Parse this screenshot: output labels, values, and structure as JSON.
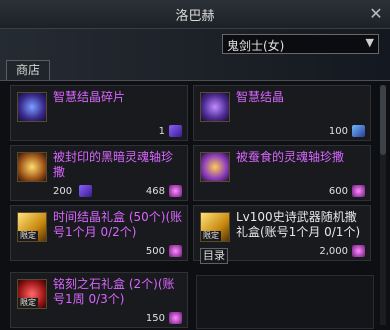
{
  "window": {
    "title": "洛巴赫"
  },
  "class_select": {
    "value": "鬼剑士(女)"
  },
  "tab": {
    "shop": "商店"
  },
  "catalog_button": "目录",
  "items": [
    {
      "name": "智慧结晶碎片",
      "price": "1",
      "icon": "wisdom-crystal-shard-icon"
    },
    {
      "name": "智慧结晶",
      "price": "100",
      "icon": "wisdom-crystal-icon"
    },
    {
      "name": "被封印的黑暗灵魂轴珍撒",
      "price_a": "200",
      "price_b": "468",
      "icon": "sealed-dark-soul-icon"
    },
    {
      "name": "被蚕食的灵魂轴珍撒",
      "price": "600",
      "icon": "eroded-soul-icon"
    },
    {
      "name": "时间结晶礼盒 (50个)(账号1个月 0/2个)",
      "price": "500",
      "tag": "限定",
      "icon": "time-crystal-box-icon"
    },
    {
      "name": "Lv100史诗武器随机撒礼盒(账号1个月 0/1个)",
      "price": "2,000",
      "tag": "限定",
      "icon": "epic-weapon-box-icon"
    },
    {
      "name": "铭刻之石礼盒 (2个)(账号1周 0/3个)",
      "price": "150",
      "tag": "限定",
      "icon": "inscription-stone-box-icon"
    }
  ]
}
